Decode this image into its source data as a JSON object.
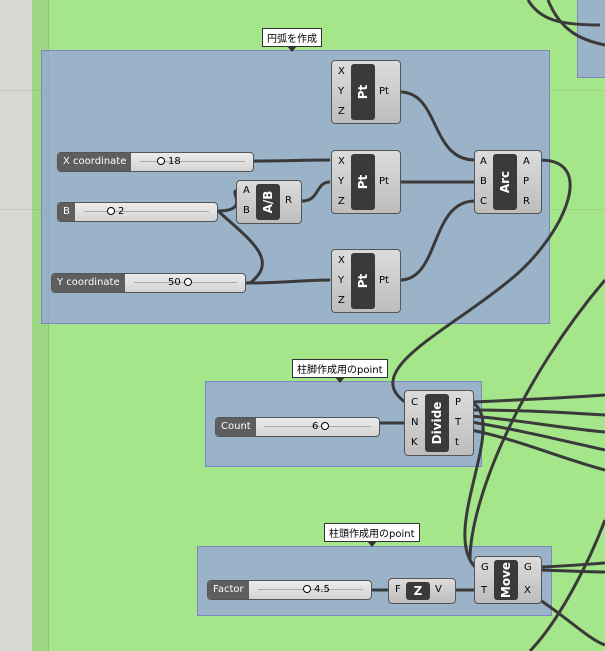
{
  "groups": {
    "arc": {
      "label": "円弧を作成"
    },
    "column_base": {
      "label": "柱脚作成用のpoint"
    },
    "column_head": {
      "label": "柱頭作成用のpoint"
    }
  },
  "components": {
    "pt": {
      "name": "Pt",
      "inputs": [
        "X",
        "Y",
        "Z"
      ],
      "output": "Pt"
    },
    "ab": {
      "name": "A/B",
      "inputs": [
        "A",
        "B"
      ],
      "output": "R"
    },
    "arc": {
      "name": "Arc",
      "inputs": [
        "A",
        "B",
        "C"
      ],
      "outputs": [
        "A",
        "P",
        "R"
      ]
    },
    "divide": {
      "name": "Divide",
      "inputs": [
        "C",
        "N",
        "K"
      ],
      "outputs": [
        "P",
        "T",
        "t"
      ]
    },
    "z": {
      "name": "Z",
      "input": "F",
      "output": "V"
    },
    "move": {
      "name": "Move",
      "inputs": [
        "G",
        "T"
      ],
      "outputs": [
        "G",
        "X"
      ]
    }
  },
  "sliders": {
    "x_coord": {
      "name": "X coordinate",
      "value": "18"
    },
    "b": {
      "name": "B",
      "value": "2"
    },
    "y_coord": {
      "name": "Y coordinate",
      "value": "50"
    },
    "count": {
      "name": "Count",
      "value": "6"
    },
    "factor": {
      "name": "Factor",
      "value": "4.5"
    }
  },
  "colors": {
    "canvas": "#a6e68b",
    "group": "#969fe1",
    "wire": "#3a3a3a"
  }
}
